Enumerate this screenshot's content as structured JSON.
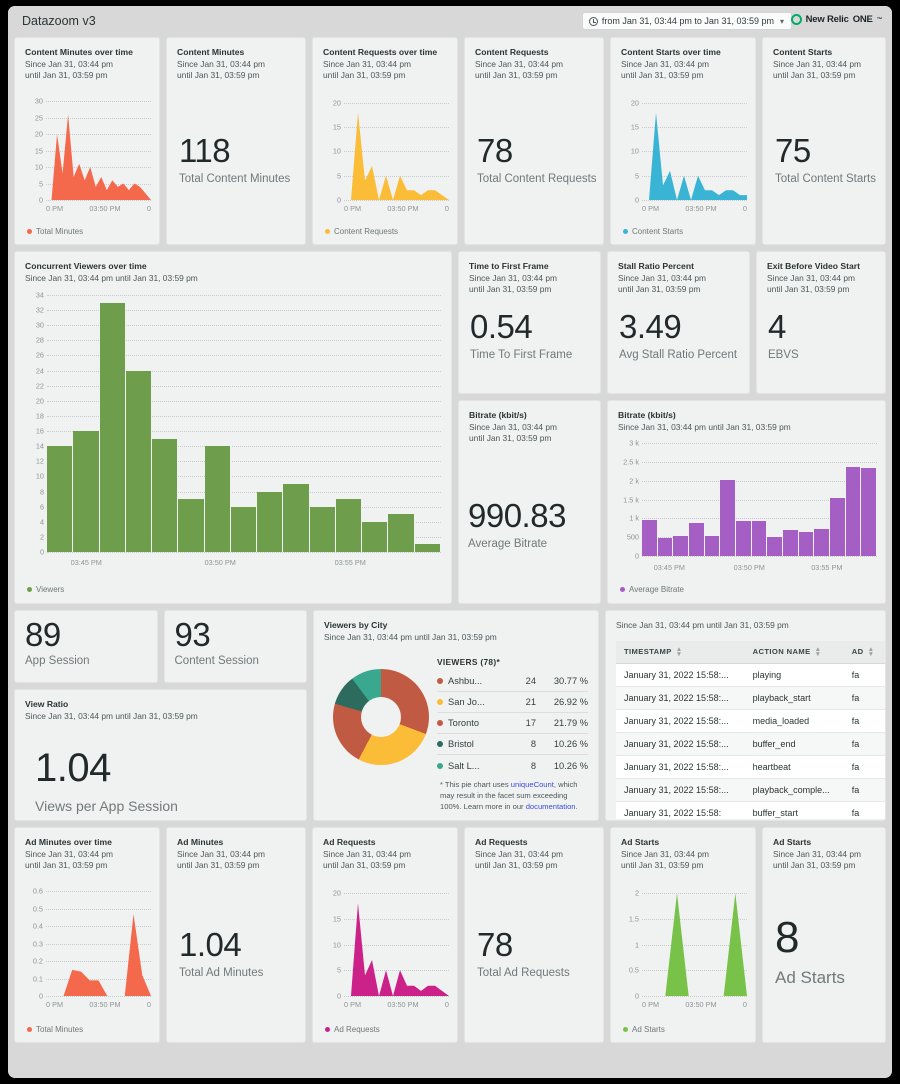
{
  "header": {
    "dashboard_title": "Datazoom v3",
    "time_range": "from Jan 31, 03:44 pm to Jan 31, 03:59 pm",
    "brand_name": "New Relic",
    "brand_product": "ONE",
    "brand_tm": "™",
    "clock_icon": "clock-icon",
    "caret_icon": "chevron-down-icon"
  },
  "colors": {
    "orange": "#f4684b",
    "yellow": "#fbbc38",
    "blue": "#3ab4d4",
    "green": "#6e9e4c",
    "purple": "#a45ec4",
    "magenta": "#cc2189",
    "lightgreen": "#79c24a",
    "pie_terracotta": "#c05a42",
    "pie_yellow": "#fbbc38",
    "pie_darkteal": "#2d6b5f",
    "pie_teal": "#3aa88f",
    "brand_green": "#00ac69"
  },
  "since_until_two_line": "Since Jan 31, 03:44 pm\nuntil Jan 31, 03:59 pm",
  "since_until_line1": "Since Jan 31, 03:44 pm",
  "since_until_line2": "until Jan 31, 03:59 pm",
  "since_until_inline": "Since Jan 31, 03:44 pm until Jan 31, 03:59 pm",
  "content_minutes_over_time": {
    "title": "Content Minutes over time",
    "legend": "Total Minutes"
  },
  "content_minutes": {
    "title": "Content Minutes",
    "value": "118",
    "caption": "Total Content Minutes"
  },
  "content_requests_over_time": {
    "title": "Content Requests over time",
    "legend": "Content Requests"
  },
  "content_requests": {
    "title": "Content Requests",
    "value": "78",
    "caption": "Total Content Requests"
  },
  "content_starts_over_time": {
    "title": "Content Starts over time",
    "legend": "Content Starts"
  },
  "content_starts": {
    "title": "Content Starts",
    "value": "75",
    "caption": "Total Content Starts"
  },
  "concurrent_viewers": {
    "title": "Concurrent Viewers over time",
    "legend": "Viewers"
  },
  "time_to_first_frame": {
    "title": "Time to First Frame",
    "value": "0.54",
    "caption": "Time To First Frame"
  },
  "stall_ratio": {
    "title": "Stall Ratio Percent",
    "value": "3.49",
    "caption": "Avg Stall Ratio Percent"
  },
  "exit_before_video_start": {
    "title": "Exit Before Video Start",
    "value": "4",
    "caption": "EBVS"
  },
  "bitrate_number": {
    "title": "Bitrate (kbit/s)",
    "value": "990.83",
    "caption": "Average Bitrate"
  },
  "bitrate_chart": {
    "title": "Bitrate (kbit/s)",
    "legend": "Average Bitrate"
  },
  "app_session": {
    "value": "89",
    "caption": "App Session"
  },
  "content_session": {
    "value": "93",
    "caption": "Content Session"
  },
  "view_ratio": {
    "title": "View Ratio",
    "value": "1.04",
    "caption": "Views per App Session"
  },
  "viewers_by_city": {
    "title": "Viewers by City",
    "table_header": "VIEWERS (78)*",
    "rows": [
      {
        "name": "Ashbu...",
        "count": "24",
        "pct": "30.77 %",
        "color": "#c05a42"
      },
      {
        "name": "San Jo...",
        "count": "21",
        "pct": "26.92 %",
        "color": "#fbbc38"
      },
      {
        "name": "Toronto",
        "count": "17",
        "pct": "21.79 %",
        "color": "#c05a42"
      },
      {
        "name": "Bristol",
        "count": "8",
        "pct": "10.26 %",
        "color": "#2d6b5f"
      },
      {
        "name": "Salt L...",
        "count": "8",
        "pct": "10.26 %",
        "color": "#3aa88f"
      }
    ],
    "footnote_a": "* This pie chart uses ",
    "footnote_link1": "uniqueCount",
    "footnote_b": ", which may result in the facet sum exceeding 100%. Learn more in our ",
    "footnote_link2": "documentation."
  },
  "events_table": {
    "columns": [
      "TIMESTAMP",
      "ACTION NAME",
      "AD"
    ],
    "rows": [
      [
        "January 31, 2022 15:58:...",
        "playing",
        "fa"
      ],
      [
        "January 31, 2022 15:58:...",
        "playback_start",
        "fa"
      ],
      [
        "January 31, 2022 15:58:...",
        "media_loaded",
        "fa"
      ],
      [
        "January 31, 2022 15:58:...",
        "buffer_end",
        "fa"
      ],
      [
        "January 31, 2022 15:58:...",
        "heartbeat",
        "fa"
      ],
      [
        "January 31, 2022 15:58:...",
        "playback_comple...",
        "fa"
      ],
      [
        "January 31, 2022 15:58:",
        "buffer_start",
        "fa"
      ]
    ],
    "sort_icon": "sort-arrows-icon"
  },
  "ad_minutes_over_time": {
    "title": "Ad Minutes over time",
    "legend": "Total Minutes"
  },
  "ad_minutes": {
    "title": "Ad Minutes",
    "value": "1.04",
    "caption": "Total Ad Minutes"
  },
  "ad_requests_chart": {
    "title": "Ad Requests",
    "legend": "Ad Requests"
  },
  "ad_requests": {
    "title": "Ad Requests",
    "value": "78",
    "caption": "Total Ad Requests"
  },
  "ad_starts_chart": {
    "title": "Ad Starts",
    "legend": "Ad Starts"
  },
  "ad_starts": {
    "title": "Ad Starts",
    "value": "8",
    "caption": "Ad Starts"
  },
  "chart_data": [
    {
      "id": "content_minutes_over_time",
      "type": "area",
      "title": "Content Minutes over time",
      "subtitle": "Since Jan 31, 03:44 pm until Jan 31, 03:59 pm",
      "xlabel": "",
      "ylabel": "",
      "yticks": [
        0,
        5,
        10,
        15,
        20,
        25,
        30
      ],
      "ylim": [
        0,
        31
      ],
      "xticks": [
        "0 PM",
        "03:50 PM",
        "0"
      ],
      "color": "#f4684b",
      "legend": [
        "Total Minutes"
      ],
      "values": [
        0,
        0,
        20,
        8,
        26,
        7,
        11,
        6,
        10,
        4,
        7,
        3,
        6,
        4,
        5,
        3,
        5,
        4,
        2,
        0
      ]
    },
    {
      "id": "content_requests_over_time",
      "type": "area",
      "title": "Content Requests over time",
      "subtitle": "Since Jan 31, 03:44 pm until Jan 31, 03:59 pm",
      "yticks": [
        0,
        5,
        10,
        15,
        20
      ],
      "ylim": [
        0,
        21
      ],
      "xticks": [
        "0 PM",
        "03:50 PM",
        "0"
      ],
      "color": "#fbbc38",
      "legend": [
        "Content Requests"
      ],
      "values": [
        0,
        0,
        18,
        4,
        7,
        0,
        5,
        0,
        5,
        2,
        2,
        1,
        2,
        2,
        1,
        0
      ]
    },
    {
      "id": "content_starts_over_time",
      "type": "area",
      "title": "Content Starts over time",
      "subtitle": "Since Jan 31, 03:44 pm until Jan 31, 03:59 pm",
      "yticks": [
        0,
        5,
        10,
        15,
        20
      ],
      "ylim": [
        0,
        21
      ],
      "xticks": [
        "0 PM",
        "03:50 PM",
        "0"
      ],
      "color": "#3ab4d4",
      "legend": [
        "Content Starts"
      ],
      "values": [
        0,
        0,
        18,
        3,
        6,
        0,
        5,
        0,
        5,
        2,
        2,
        1,
        2,
        2,
        1,
        1
      ]
    },
    {
      "id": "concurrent_viewers",
      "type": "bar",
      "title": "Concurrent Viewers over time",
      "subtitle": "Since Jan 31, 03:44 pm until Jan 31, 03:59 pm",
      "yticks": [
        0,
        2,
        4,
        6,
        8,
        10,
        12,
        14,
        16,
        18,
        20,
        22,
        24,
        26,
        28,
        30,
        32,
        34
      ],
      "ylim": [
        0,
        34
      ],
      "xticks": [
        "03:45 PM",
        "03:50 PM",
        "03:55 PM"
      ],
      "color": "#6e9e4c",
      "legend": [
        "Viewers"
      ],
      "values": [
        14,
        16,
        33,
        24,
        15,
        7,
        14,
        6,
        8,
        9,
        6,
        7,
        4,
        5,
        1
      ]
    },
    {
      "id": "bitrate_chart",
      "type": "bar",
      "title": "Bitrate (kbit/s)",
      "subtitle": "Since Jan 31, 03:44 pm until Jan 31, 03:59 pm",
      "yticks": [
        "0",
        "500",
        "1 k",
        "1.5 k",
        "2 k",
        "2.5 k",
        "3 k"
      ],
      "ylim": [
        0,
        3000
      ],
      "xticks": [
        "03:45 PM",
        "03:50 PM",
        "03:55 PM"
      ],
      "color": "#a45ec4",
      "legend": [
        "Average Bitrate"
      ],
      "values": [
        950,
        490,
        520,
        870,
        540,
        2030,
        920,
        930,
        510,
        700,
        650,
        720,
        1530,
        2350,
        2330
      ]
    },
    {
      "id": "viewers_by_city",
      "type": "pie",
      "title": "Viewers by City",
      "subtitle": "Since Jan 31, 03:44 pm until Jan 31, 03:59 pm",
      "labels": [
        "Ashbu...",
        "San Jo...",
        "Toronto",
        "Bristol",
        "Salt L..."
      ],
      "values": [
        24,
        21,
        17,
        8,
        8
      ],
      "percents": [
        30.77,
        26.92,
        21.79,
        10.26,
        10.26
      ],
      "colors": [
        "#c05a42",
        "#fbbc38",
        "#c05a42",
        "#2d6b5f",
        "#3aa88f"
      ],
      "legend_position": "right"
    },
    {
      "id": "ad_minutes_over_time",
      "type": "area",
      "title": "Ad Minutes over time",
      "subtitle": "Since Jan 31, 03:44 pm until Jan 31, 03:59 pm",
      "yticks": [
        0,
        0.1,
        0.2,
        0.3,
        0.4,
        0.5,
        0.6
      ],
      "ylim": [
        0,
        0.62
      ],
      "xticks": [
        "0 PM",
        "03:50 PM",
        "0"
      ],
      "color": "#f4684b",
      "legend": [
        "Total Minutes"
      ],
      "values": [
        0,
        0,
        0,
        0.15,
        0.14,
        0.09,
        0.09,
        0,
        0,
        0,
        0.47,
        0.12,
        0
      ]
    },
    {
      "id": "ad_requests_chart",
      "type": "area",
      "title": "Ad Requests",
      "subtitle": "Since Jan 31, 03:44 pm until Jan 31, 03:59 pm",
      "yticks": [
        0,
        5,
        10,
        15,
        20
      ],
      "ylim": [
        0,
        21
      ],
      "xticks": [
        "0 PM",
        "03:50 PM",
        "0"
      ],
      "color": "#cc2189",
      "legend": [
        "Ad Requests"
      ],
      "values": [
        0,
        0,
        18,
        4,
        7,
        0,
        5,
        0,
        5,
        2,
        2,
        1,
        2,
        2,
        1,
        0
      ]
    },
    {
      "id": "ad_starts_chart",
      "type": "area",
      "title": "Ad Starts",
      "subtitle": "Since Jan 31, 03:44 pm until Jan 31, 03:59 pm",
      "yticks": [
        0,
        0.5,
        1,
        1.5,
        2
      ],
      "ylim": [
        0,
        2.1
      ],
      "xticks": [
        "0 PM",
        "03:50 PM",
        "0"
      ],
      "color": "#79c24a",
      "legend": [
        "Ad Starts"
      ],
      "values": [
        0,
        0,
        0,
        2,
        0,
        0,
        0,
        0,
        2,
        0
      ]
    }
  ]
}
